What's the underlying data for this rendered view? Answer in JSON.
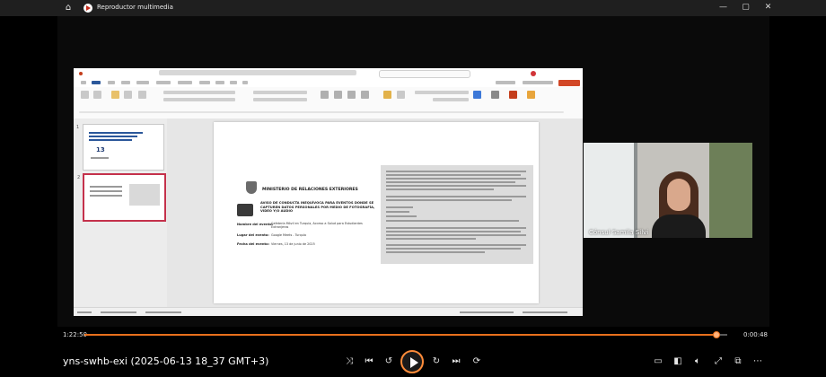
{
  "window": {
    "title": "Reproductor multimedia",
    "icons": {
      "home": "home-icon",
      "app": "media-player-icon",
      "minimize": "minimize-icon",
      "maximize": "maximize-icon",
      "close": "close-icon"
    }
  },
  "video": {
    "slide": {
      "ministry": "MINISTERIO DE RELACIONES EXTERIORES",
      "notice": "AVISO DE CONDUCTA INEQUÍVOCA PARA EVENTOS DONDE SE CAPTUREN DATOS PERSONALES POR MEDIO DE FOTOGRAFÍA, VIDEO Y/O AUDIO",
      "event_name_label": "Nombre del evento:",
      "event_name_value": "Cafetería Móvil en Turquía, Acceso a Salud para Estudiantes Extranjeros",
      "place_label": "Lugar del evento:",
      "place_value": "Google Meets - Turquía",
      "date_label": "Fecha del evento:",
      "date_value": "Viernes, 13 de junio de 2025",
      "thumbnail_number": "13"
    },
    "participant": "Cónsul Samila Silvi"
  },
  "player": {
    "elapsed": "1:22:50",
    "remaining": "0:00:48",
    "progress": 0.983,
    "file_title": "yns-swhb-exi (2025-06-13 18_37 GMT+3)",
    "accent_color": "#e8701c",
    "controls": {
      "shuffle": "shuffle-icon",
      "previous": "previous-icon",
      "rewind": "skip-back-10-icon",
      "play": "play-icon",
      "forward": "skip-forward-30-icon",
      "next": "next-icon",
      "repeat": "repeat-icon",
      "volume": "volume-icon",
      "cast": "cast-icon",
      "fullscreen": "fullscreen-icon",
      "miniplayer": "mini-player-icon",
      "more": "more-options-icon"
    }
  }
}
